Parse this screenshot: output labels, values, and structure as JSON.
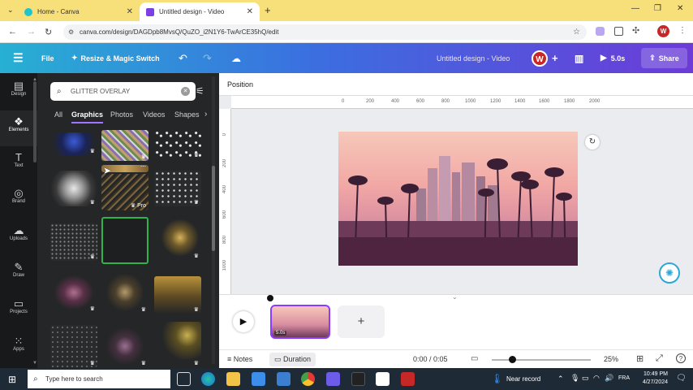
{
  "browser": {
    "tabs": [
      {
        "title": "Home - Canva",
        "active": false
      },
      {
        "title": "Untitled design - Video",
        "active": true
      }
    ],
    "url": "canva.com/design/DAGDpb8MvsQ/QuZO_i2N1Y6-TwArCE35hQ/edit",
    "profile_initial": "W"
  },
  "header": {
    "file_label": "File",
    "resize_label": "Resize & Magic Switch",
    "design_title": "Untitled design - Video",
    "user_initial": "W",
    "duration_label": "5.0s",
    "share_label": "Share"
  },
  "rail": {
    "items": [
      {
        "label": "Design",
        "icon": "design-icon"
      },
      {
        "label": "Elements",
        "icon": "elements-icon"
      },
      {
        "label": "Text",
        "icon": "text-icon"
      },
      {
        "label": "Brand",
        "icon": "brand-icon"
      },
      {
        "label": "Uploads",
        "icon": "uploads-icon"
      },
      {
        "label": "Draw",
        "icon": "draw-icon"
      },
      {
        "label": "Projects",
        "icon": "projects-icon"
      },
      {
        "label": "Apps",
        "icon": "apps-icon"
      }
    ],
    "active": "Elements"
  },
  "panel": {
    "search_value": "GLITTER OVERLAY",
    "filter_tabs": [
      "All",
      "Graphics",
      "Photos",
      "Videos",
      "Shapes"
    ],
    "active_filter": "Graphics",
    "pro_label": "Pro"
  },
  "toolbar": {
    "position_label": "Position"
  },
  "ruler": {
    "h_ticks": [
      "0",
      "200",
      "400",
      "600",
      "800",
      "1000",
      "1200",
      "1400",
      "1600",
      "1800",
      "2000"
    ],
    "v_ticks": [
      "0",
      "200",
      "400",
      "600",
      "800",
      "1000"
    ]
  },
  "timeline": {
    "clip_duration": "5.0s"
  },
  "footer": {
    "notes_label": "Notes",
    "duration_label": "Duration",
    "time_readout": "0:00 / 0:05",
    "zoom_level": "25%"
  },
  "taskbar": {
    "search_placeholder": "Type here to search",
    "weather": "Near record",
    "language": "FRA",
    "time": "10:49 PM",
    "date": "4/27/2024"
  },
  "colors": {
    "accent": "#8b3dff",
    "panel_bg": "#252627",
    "rail_bg": "#18191b",
    "header_start": "#27b0d3",
    "header_end": "#6c3bd8"
  }
}
